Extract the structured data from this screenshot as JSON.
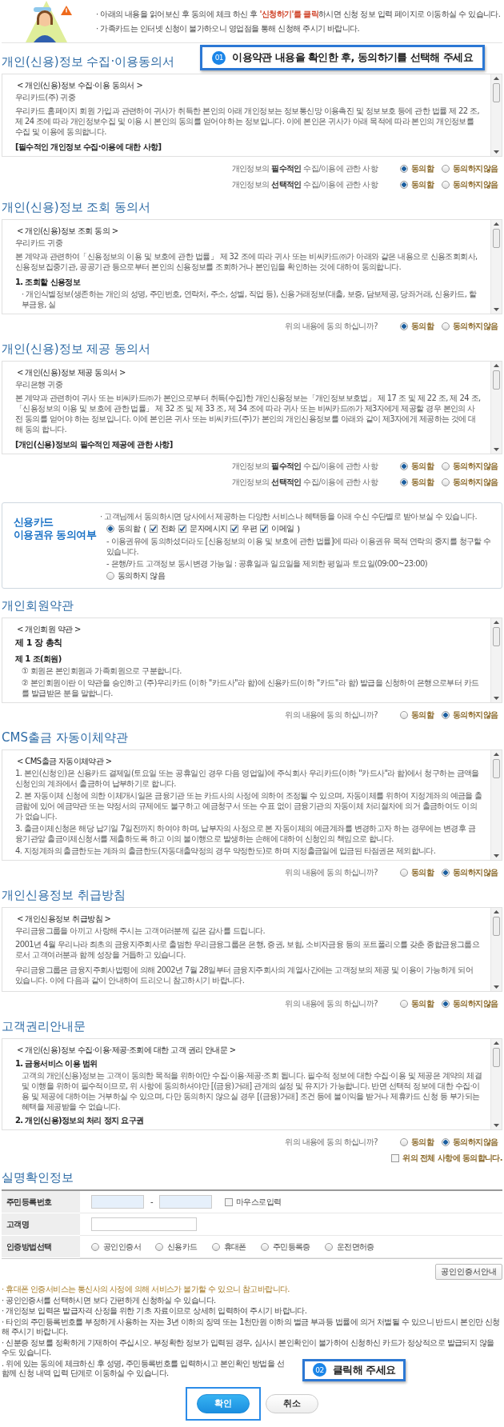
{
  "notice": {
    "lines": [
      {
        "segments": [
          {
            "kind": "plain",
            "text": "· 아래의 내용을 읽어보신 후 동의에 체크 하신 후 "
          },
          {
            "kind": "highlight",
            "text": "'신청하기'를 클릭"
          },
          {
            "kind": "plain",
            "text": "하시면 신청 정보 입력 페이지로 이동하실 수 있습니다."
          }
        ]
      },
      {
        "segments": [
          {
            "kind": "plain",
            "text": "· 가족카드는 인터넷 신청이 불가하오니 영업점을 통해 신청해 주시기 바랍니다."
          }
        ]
      }
    ]
  },
  "callout_top": {
    "badge": "01",
    "text": "이용약관 내용을 확인한 후, 동의하기를 선택해 주세요"
  },
  "blocks": [
    {
      "kind": "terms",
      "title": "개인(신용)정보 수집·이용동의서",
      "document": [
        {
          "kind": "caption",
          "text": "< 개인(신용)정보 수집·이용 동의서 >"
        },
        {
          "kind": "text",
          "text": "우리카드(주) 귀중"
        },
        {
          "kind": "para",
          "text": "우리카드 홈페이지 회원 가입과 관련하여 귀사가 취득한 본인의 아래 개인정보는 정보통신망 이용촉진 및 정보보호 등에 관한 법률 제 22 조, 제 24 조에 따라 개인정보수집 및 이용 시 본인의 동의를 얻어야 하는 정보입니다. 이에 본인은 귀사가 아래 목적에 따라 본인의 개인정보를 수집 및 이용에 동의합니다."
        },
        {
          "kind": "heading",
          "text": "[필수적인 개인정보 수집·이용에 대한 사항]"
        }
      ],
      "consents": [
        {
          "label": "개인정보의 **필수적인** 수집/이용에 관한 사항",
          "options": [
            {
              "label": "동의함",
              "selected": true
            },
            {
              "label": "동의하지않음",
              "selected": false
            }
          ]
        },
        {
          "label": "개인정보의 **선택적인** 수집/이용에 관한 사항",
          "options": [
            {
              "label": "동의함",
              "selected": true
            },
            {
              "label": "동의하지않음",
              "selected": false
            }
          ]
        }
      ]
    },
    {
      "kind": "terms",
      "title": "개인(신용)정보 조회 동의서",
      "document": [
        {
          "kind": "caption",
          "text": "< 개인(신용)정보 조회 동의 >"
        },
        {
          "kind": "text",
          "text": "우리카드 귀중"
        },
        {
          "kind": "para",
          "text": "본 계약과 관련하여「신용정보의 이용 및 보호에 관한 법률」 제 32 조에 따라 귀사 또는 비씨카드㈜가 아래와 같은 내용으로 신용조회회사, 신용정보집중기관, 공공기관 등으로부터 본인의 신용정보를 조회하거나 본인임을 확인하는 것에 대하여 동의합니다."
        },
        {
          "kind": "heading",
          "text": "1. 조회할 신용정보"
        },
        {
          "kind": "item",
          "text": "· 개인식별정보(생존하는 개인의 성명, 주민번호, 연락처, 주소, 성별, 직업 등), 신용거래정보(대출, 보증, 담보제공, 당좌거래, 신용카드, 할부금융, 실"
        }
      ],
      "consents": [
        {
          "label": "위의 내용에 동의 하십니까?",
          "options": [
            {
              "label": "동의함",
              "selected": true
            },
            {
              "label": "동의하지않음",
              "selected": false
            }
          ]
        }
      ]
    },
    {
      "kind": "terms",
      "title": "개인(신용)정보 제공 동의서",
      "document": [
        {
          "kind": "caption",
          "text": "< 개인(신용)정보 제공 동의서 >"
        },
        {
          "kind": "text",
          "text": "우리은행 귀중"
        },
        {
          "kind": "para",
          "text": "본 계약과 관련하여 귀사 또는 비씨카드㈜가 본인으로부터 취득(수집)한 개인신용정보는「개인정보보호법」 제 17 조 및 제 22 조, 제 24 조,「신용정보의 이용 및 보호에 관한 법률」 제 32 조 및 제 33 조, 제 34 조에 따라 귀사 또는 비씨카드㈜가 제3자에게 제공할 경우 본인의 사전 동의를 얻어야 하는 정보입니다. 이에 본인은 귀사 또는 비씨카드(주)가 본인의 개인신용정보를 아래와 같이 제3자에게 제공하는 것에 대해 동의 합니다."
        },
        {
          "kind": "heading",
          "text": "[개인(신용)정보의 필수적인 제공에 관한 사항]"
        }
      ],
      "consents": [
        {
          "label": "개인정보의 **필수적인** 수집/이용에 관한 사항",
          "options": [
            {
              "label": "동의함",
              "selected": true
            },
            {
              "label": "동의하지않음",
              "selected": false
            }
          ]
        },
        {
          "label": "개인정보의 **선택적인** 수집/이용에 관한 사항",
          "options": [
            {
              "label": "동의함",
              "selected": true
            },
            {
              "label": "동의하지않음",
              "selected": false
            }
          ]
        }
      ]
    },
    {
      "kind": "marketing",
      "title_lines": [
        "신용카드",
        "이용권유 동의여부"
      ],
      "intro": "· 고객님께서 동의하시면 당사에서 제공하는 다양한 서비스나 혜택등을 아래 수신 수단별로 받아보실 수 있습니다.",
      "agree": {
        "label": "동의함",
        "selected": true,
        "paren_open": "(",
        "paren_close": ")",
        "channels": [
          {
            "label": "전화",
            "checked": true
          },
          {
            "label": "문자메시지",
            "checked": true
          },
          {
            "label": "우편",
            "checked": true
          },
          {
            "label": "이메일",
            "checked": true
          }
        ]
      },
      "notes": [
        "- 이용권유에 동의하셨더라도 [신용정보의 이용 및 보호에 관한 법률]에 따라 이용권유 목적 연락의 중지를 청구할 수 있습니다.",
        "- 은행/카드 고객정보 동시변경 가능일 : 공휴일과 일요일을 제외한 평일과 토요일(09:00~23:00)"
      ],
      "disagree": {
        "label": "동의하지 않음",
        "selected": false
      }
    },
    {
      "kind": "terms",
      "title": "개인회원약관",
      "document": [
        {
          "kind": "caption",
          "text": "< 개인회원 약관 >"
        },
        {
          "kind": "chapter",
          "text": "제 1 장 총칙"
        },
        {
          "kind": "heading",
          "text": "제 1 조(회원)"
        },
        {
          "kind": "item",
          "text": "① 회원은 본인회원과 가족회원으로 구분합니다."
        },
        {
          "kind": "item",
          "text": "② 본인회원이란 이 약관을 승인하고 (주)우리카드 (이하 \"카드사\"라 함)에 신용카드(이하 \"카드\"라 함) 발급을 신청하여 은행으로부터 카드를 발급받은 분을 말합니다."
        }
      ],
      "consents": [
        {
          "label": "위의 내용에 동의 하십니까?",
          "options": [
            {
              "label": "동의함",
              "selected": false
            },
            {
              "label": "동의하지않음",
              "selected": true
            }
          ]
        }
      ]
    },
    {
      "kind": "terms",
      "title": "CMS출금 자동이체약관",
      "document": [
        {
          "kind": "caption",
          "text": "< CMS출금 자동이체약관 >"
        },
        {
          "kind": "text",
          "text": "1. 본인(신청인)은 신용카드 결제일(토요일 또는 공휴일인 경우 다음 영업일)에 주식회사 우리카드(이하 \"카드사\"라 함)에서 청구하는 금액을 신청인의 계좌에서 출금하여 납부하기로 합니다."
        },
        {
          "kind": "text",
          "text": "2. 본 자동이체 신청에 의한 이체개시일은 금융기관 또는 카드사의 사정에 의하여 조정될 수 있으며, 자동이체를 위하여 지정계좌의 예금을 출금함에 있어 예금약관 또는 약정서의 규제에도 불구하고 예금청구서 또는 수표 없이 금융기관의 자동이체 처리절차에 의거 출금하여도 이의가 없습니다."
        },
        {
          "kind": "text",
          "text": "3. 출금이체신청은 해당 납기일 7일전까지 하여야 하며, 납부자의 사정으로 본 자동이체의 예금계좌를 변경하고자 하는 경우에는 변경후 금융기관앞 출금이체신청서를 제출하도록 하고 이의 불이행으로 발생하는 손해에 대하여 신청인의 책임으로 합니다."
        },
        {
          "kind": "text",
          "text": "4. 지정계좌의 출금한도는 계좌의 출금한도(자동대출약정의 경우 약정한도)로 하며 지정출금일에 입금된 타점권은 제외합니다."
        }
      ],
      "consents": [
        {
          "label": "위의 내용에 동의 하십니까?",
          "options": [
            {
              "label": "동의함",
              "selected": false
            },
            {
              "label": "동의하지않음",
              "selected": true
            }
          ]
        }
      ]
    },
    {
      "kind": "terms",
      "title": "개인신용정보 취급방침",
      "document": [
        {
          "kind": "caption",
          "text": "< 개인신용정보 취급방침 >"
        },
        {
          "kind": "text",
          "text": "우리금융그룹을 아끼고 사랑해 주시는 고객여러분께 깊은 감사를 드립니다."
        },
        {
          "kind": "para",
          "text": "2001년 4월 우리나라 최초의 금융지주회사로 출범한 우리금융그룹은 은행, 증권, 보험, 소비자금융 등의 포트폴리오를 갖춘 종합금융그룹으로서 고객여러분과 함께 성장을 거듭하고 있습니다."
        },
        {
          "kind": "para",
          "text": "우리금융그룹은 금융지주회사법령에 의해 2002년 7월 28일부터 금융지주회사의 계열사간에는 고객정보의 제공 및 이용이 가능하게 되어 있습니다. 이에 다음과 같이 안내하여 드리오니 참고하시기 바랍니다."
        }
      ],
      "consents": [
        {
          "label": "위의 내용에 동의 하십니까?",
          "options": [
            {
              "label": "동의함",
              "selected": false
            },
            {
              "label": "동의하지않음",
              "selected": true
            }
          ]
        }
      ]
    },
    {
      "kind": "terms",
      "title": "고객권리안내문",
      "document": [
        {
          "kind": "caption",
          "text": "< 개인(신용)정보 수집·이용·제공·조회에 대한 고객 권리 안내문 >"
        },
        {
          "kind": "heading",
          "text": "1. 금융서비스 이용 범위"
        },
        {
          "kind": "item",
          "text": "고객의 개인(신용)정보는 고객이 동의한 목적을 위하여만 수집·이용·제공·조회 됩니다. 필수적 정보에 대한 수집·이용 및 제공은 계약의 체결 및 이행을 위하여 필수적이므로, 위 사항에 동의하셔야만 [(금융)거래] 관계의 설정 및 유지가 가능합니다. 반면 선택적 정보에 대한 수집·이용 및 제공에 대하여는 거부하실 수 있으며, 다만 동의하지 않으실 경우 [(금융)거래] 조건 등에 불이익을 받거나 제휴카드 신청 등 부가되는 혜택을 제공받을 수 없습니다."
        },
        {
          "kind": "heading",
          "text": "2. 개인(신용)정보의 처리 정지 요구권"
        }
      ],
      "consents": [
        {
          "label": "위의 내용에 동의 하십니까?",
          "options": [
            {
              "label": "동의함",
              "selected": false
            },
            {
              "label": "동의하지않음",
              "selected": true
            }
          ]
        }
      ],
      "agree_all": {
        "label": "위의 전체 사항에 동의합니다.",
        "checked": false
      }
    }
  ],
  "identity": {
    "title": "실명확인정보",
    "rows": [
      {
        "kind": "id_number",
        "label": "주민등록번호",
        "separator": "-",
        "mouse_input": {
          "label": "마우스로입력",
          "checked": false
        }
      },
      {
        "kind": "name",
        "label": "고객명"
      },
      {
        "kind": "method",
        "label": "인증방법선택",
        "options": [
          {
            "label": "공인인증서",
            "selected": false
          },
          {
            "label": "신용카드",
            "selected": false
          },
          {
            "label": "휴대폰",
            "selected": false
          },
          {
            "label": "주민등록증",
            "selected": false
          },
          {
            "label": "운전면허증",
            "selected": false
          }
        ]
      }
    ],
    "guide_button": "공인인증서안내"
  },
  "notes": [
    {
      "kind": "warning",
      "text": "· 휴대폰 인증서비스는 통신사의 사정에 의해 서비스가 불가할 수 있으니 참고바랍니다."
    },
    {
      "kind": "plain",
      "text": "· 공인인증서를 선택하시면 보다 간편하게 신청하실 수 있습니다."
    },
    {
      "kind": "plain",
      "text": "· 개인정보 입력은 발급자격 산정을 위한 기초 자료이므로 상세히 입력하여 주시기 바랍니다."
    },
    {
      "kind": "plain",
      "text": "· 타인의 주민등록번호를 부정하게 사용하는 자는 3년 이하의 징역 또는 1천만원 이하의 벌금 부과등 법률에 의거 처벌될 수 있으니 반드시 본인만 신청해 주시기 바랍니다."
    },
    {
      "kind": "plain",
      "text": "· 신분증 정보를 정확하게 기재하여 주십시오. 부정확한 정보가 입력된 경우, 심사시 본인확인이 불가하여 신청하신 카드가 정상적으로 발급되지 않을 수도 있습니다."
    }
  ],
  "last_note": {
    "before": ". 위에 있는 동의에 체크하신 후 성명, 주민등록번호를 입력하시고 본인확인 방법을 선",
    "after": "함께 신청 내역 입력 단계로 이동하실 수 있습니다."
  },
  "callout_bottom": {
    "badge": "02",
    "text": "클릭해 주세요"
  },
  "buttons": [
    {
      "kind": "primary",
      "label": "확인"
    },
    {
      "kind": "secondary",
      "label": "취소"
    }
  ]
}
